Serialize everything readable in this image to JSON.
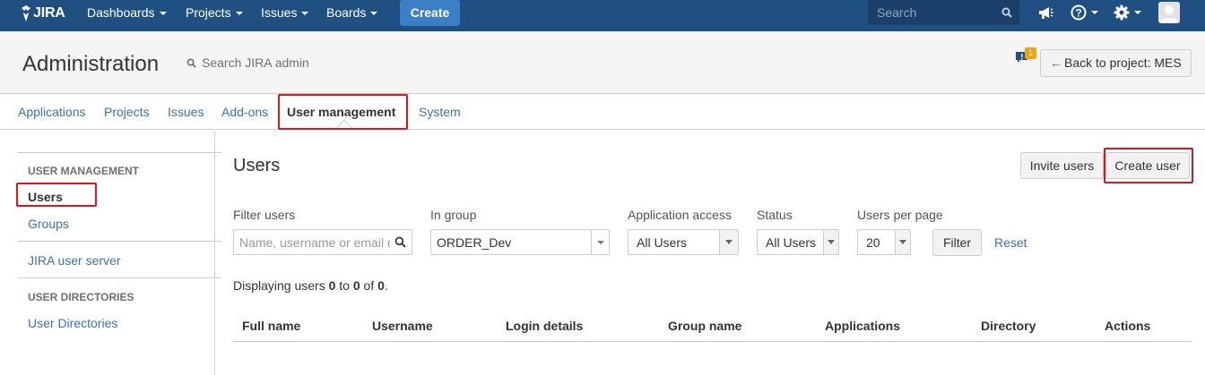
{
  "topbar": {
    "logo_text": "JIRA",
    "nav": [
      "Dashboards",
      "Projects",
      "Issues",
      "Boards"
    ],
    "create_label": "Create",
    "search_placeholder": "Search",
    "brand_color": "#205081"
  },
  "admin_header": {
    "title": "Administration",
    "search_text": "Search JIRA admin",
    "notification_count": "1",
    "back_button_label": "Back to project: MES"
  },
  "admin_tabs": {
    "items": [
      "Applications",
      "Projects",
      "Issues",
      "Add-ons",
      "User management",
      "System"
    ],
    "active": "User management"
  },
  "sidebar": {
    "section1_heading": "USER MANAGEMENT",
    "users_label": "Users",
    "groups_label": "Groups",
    "user_server_label": "JIRA user server",
    "section2_heading": "USER DIRECTORIES",
    "user_directories_label": "User Directories",
    "active": "Users"
  },
  "main": {
    "title": "Users",
    "invite_button": "Invite users",
    "create_button": "Create user",
    "filters": {
      "filter_users_label": "Filter users",
      "filter_users_placeholder": "Name, username or email d",
      "in_group_label": "In group",
      "in_group_value": "ORDER_Dev",
      "application_access_label": "Application access",
      "application_access_value": "All Users",
      "status_label": "Status",
      "status_value": "All Users",
      "users_per_page_label": "Users per page",
      "users_per_page_value": "20",
      "filter_button": "Filter",
      "reset_link": "Reset"
    },
    "display": {
      "prefix": "Displaying users ",
      "from": "0",
      "to_word": " to ",
      "to": "0",
      "of_word": " of ",
      "total": "0",
      "suffix": "."
    },
    "table_headers": [
      "Full name",
      "Username",
      "Login details",
      "Group name",
      "Applications",
      "Directory",
      "Actions"
    ]
  },
  "colors": {
    "link": "#3b73af",
    "highlight": "#e0141e",
    "accent": "#3b7fc4"
  }
}
